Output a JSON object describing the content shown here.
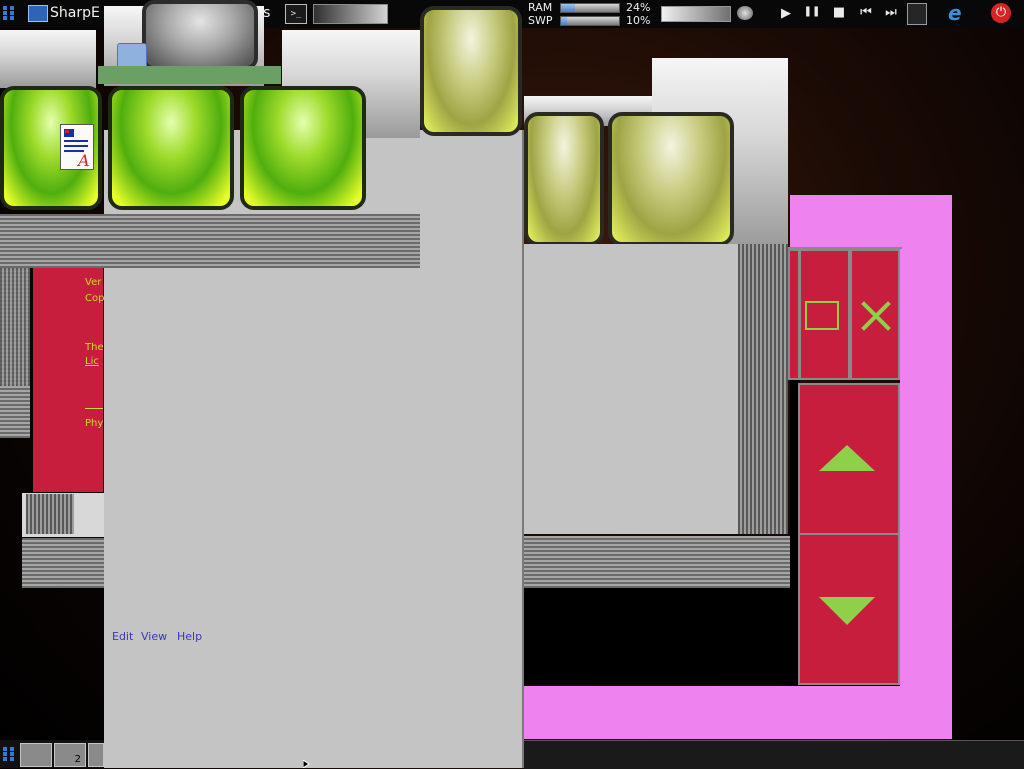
{
  "taskbar": {
    "sharp_label": "SharpE",
    "notes_label": "Notes",
    "terminal_glyph": ">_",
    "ram_label": "RAM",
    "ram_percent": "24%",
    "ram_fraction": 0.24,
    "swap_label": "SWP",
    "swap_percent": "10%",
    "swap_fraction": 0.1,
    "media": {
      "play": "▶",
      "pause": "❚❚",
      "stop": "■",
      "prev": "⏮",
      "next": "⏭"
    },
    "browser_glyph": "e",
    "power_glyph": "⏻"
  },
  "bottom_bar": {
    "page_number": "2"
  },
  "menu": {
    "edit": "Edit",
    "view": "View",
    "help": "Help"
  },
  "about": {
    "line1": "Ver",
    "line2": "Cop",
    "line3": "The",
    "line4": "Lic",
    "line5": "Phy"
  },
  "control_panel": {
    "maximize_glyph": "□",
    "close_glyph": "✕",
    "up_glyph": "▲",
    "down_glyph": "▼"
  },
  "colors": {
    "pink": "#ee82ee",
    "crimson": "#c81e3e",
    "accent_green": "#8ed04a",
    "menu_link": "#3838b8"
  },
  "icons": [
    "sharpe-desktop-icon",
    "notes-icon",
    "terminal-icon",
    "document-icon",
    "network-icon",
    "browser-icon",
    "power-icon"
  ]
}
